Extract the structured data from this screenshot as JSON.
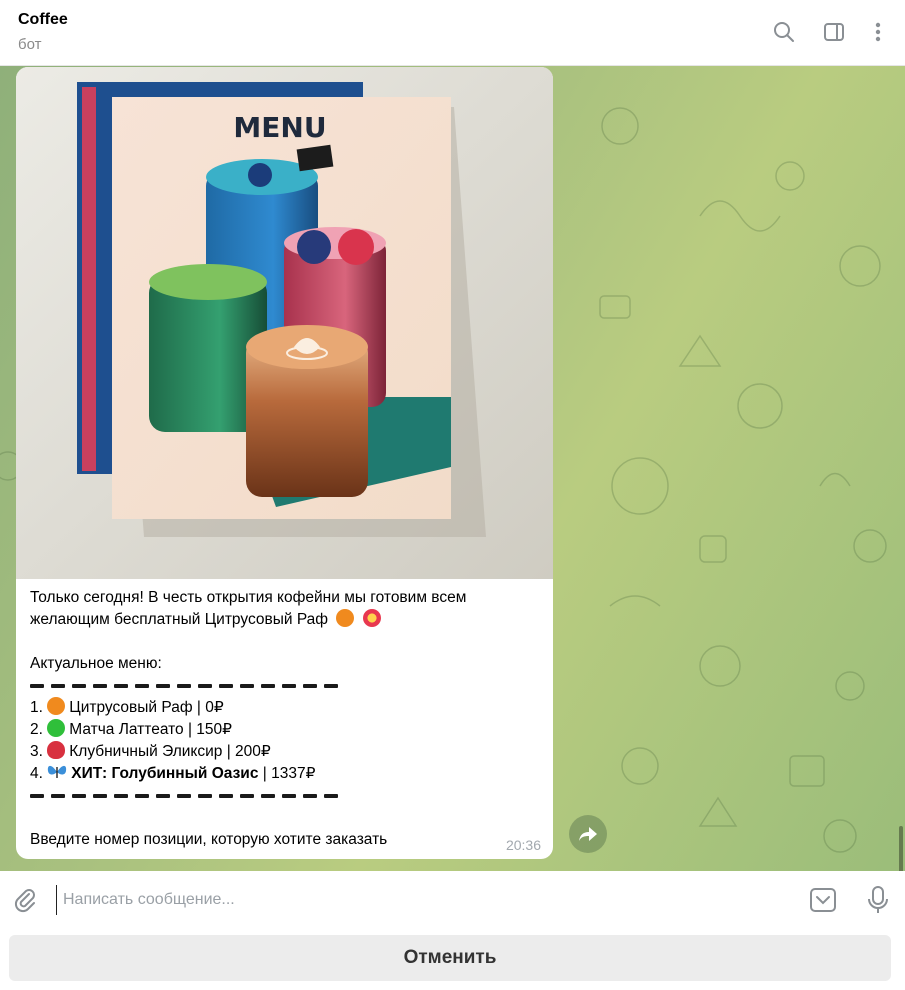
{
  "header": {
    "title": "Coffee",
    "subtitle": "бот",
    "icons": [
      "search-icon",
      "sidebar-toggle-icon",
      "more-vertical-icon"
    ]
  },
  "message": {
    "image": {
      "menu_title": "MENU"
    },
    "lines": {
      "intro1": "Только сегодня! В честь открытия кофейни мы готовим всем",
      "intro2": "желающим бесплатный Цитрусовый Раф",
      "menu_header": "Актуальное меню:",
      "items": [
        {
          "num": "1.",
          "emoji": "orange",
          "name": "Цитрусовый Раф",
          "price": "| 0₽"
        },
        {
          "num": "2.",
          "emoji": "green-circle",
          "name": "Матча Латтеато",
          "price": "| 150₽"
        },
        {
          "num": "3.",
          "emoji": "strawberry",
          "name": "Клубничный Эликсир",
          "price": "| 200₽"
        },
        {
          "num": "4.",
          "emoji": "butterfly",
          "name": "ХИТ: Голубинный Оазис",
          "price": "| 1337₽"
        }
      ],
      "prompt": "Введите номер позиции, которую хотите заказать"
    },
    "time": "20:36"
  },
  "composer": {
    "placeholder": "Написать сообщение..."
  },
  "bot_keyboard": {
    "cancel_label": "Отменить"
  },
  "colors": {
    "chat_bg": "#a9c17f",
    "bubble": "#ffffff",
    "kb_button": "#ececec"
  }
}
